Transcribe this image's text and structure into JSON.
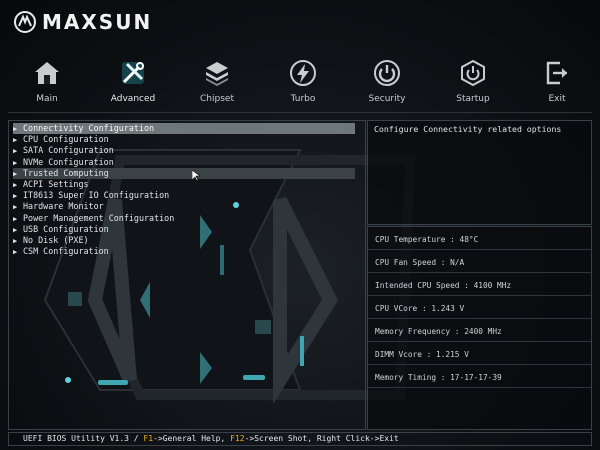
{
  "brand": {
    "name": "MAXSUN"
  },
  "tabs": [
    {
      "label": "Main",
      "icon": "home-icon"
    },
    {
      "label": "Advanced",
      "icon": "tools-icon",
      "active": true
    },
    {
      "label": "Chipset",
      "icon": "chip-icon"
    },
    {
      "label": "Turbo",
      "icon": "lightning-icon"
    },
    {
      "label": "Security",
      "icon": "power-icon"
    },
    {
      "label": "Startup",
      "icon": "hexagon-power-icon"
    },
    {
      "label": "Exit",
      "icon": "exit-icon"
    }
  ],
  "menu": {
    "items": [
      "Connectivity Configuration",
      "CPU Configuration",
      "SATA Configuration",
      "NVMe Configuration",
      "Trusted Computing",
      "ACPI Settings",
      "IT8613 Super IO Configuration",
      "Hardware Monitor",
      "Power Management Configuration",
      "USB Configuration",
      "No Disk (PXE)",
      "CSM Configuration"
    ],
    "selected_index": 0,
    "hover_index": 4
  },
  "help": {
    "text": "Configure Connectivity related options"
  },
  "info": {
    "rows": [
      "CPU Temperature : 48°C",
      "CPU Fan Speed : N/A",
      "Intended CPU Speed : 4100 MHz",
      "CPU VCore : 1.243 V",
      "Memory Frequency : 2400 MHz",
      "DIMM Vcore : 1.215 V",
      "Memory Timing : 17-17-17-39"
    ]
  },
  "status": {
    "prefix": "UEFI BIOS Utility V1.3 / ",
    "f1_key": "F1",
    "f1_text": "->General Help, ",
    "f12_key": "F12",
    "f12_text": "->Screen Shot, Right Click->Exit"
  },
  "colors": {
    "accent": "#f0b400",
    "selection": "#6e7779",
    "border": "#3a4148"
  }
}
